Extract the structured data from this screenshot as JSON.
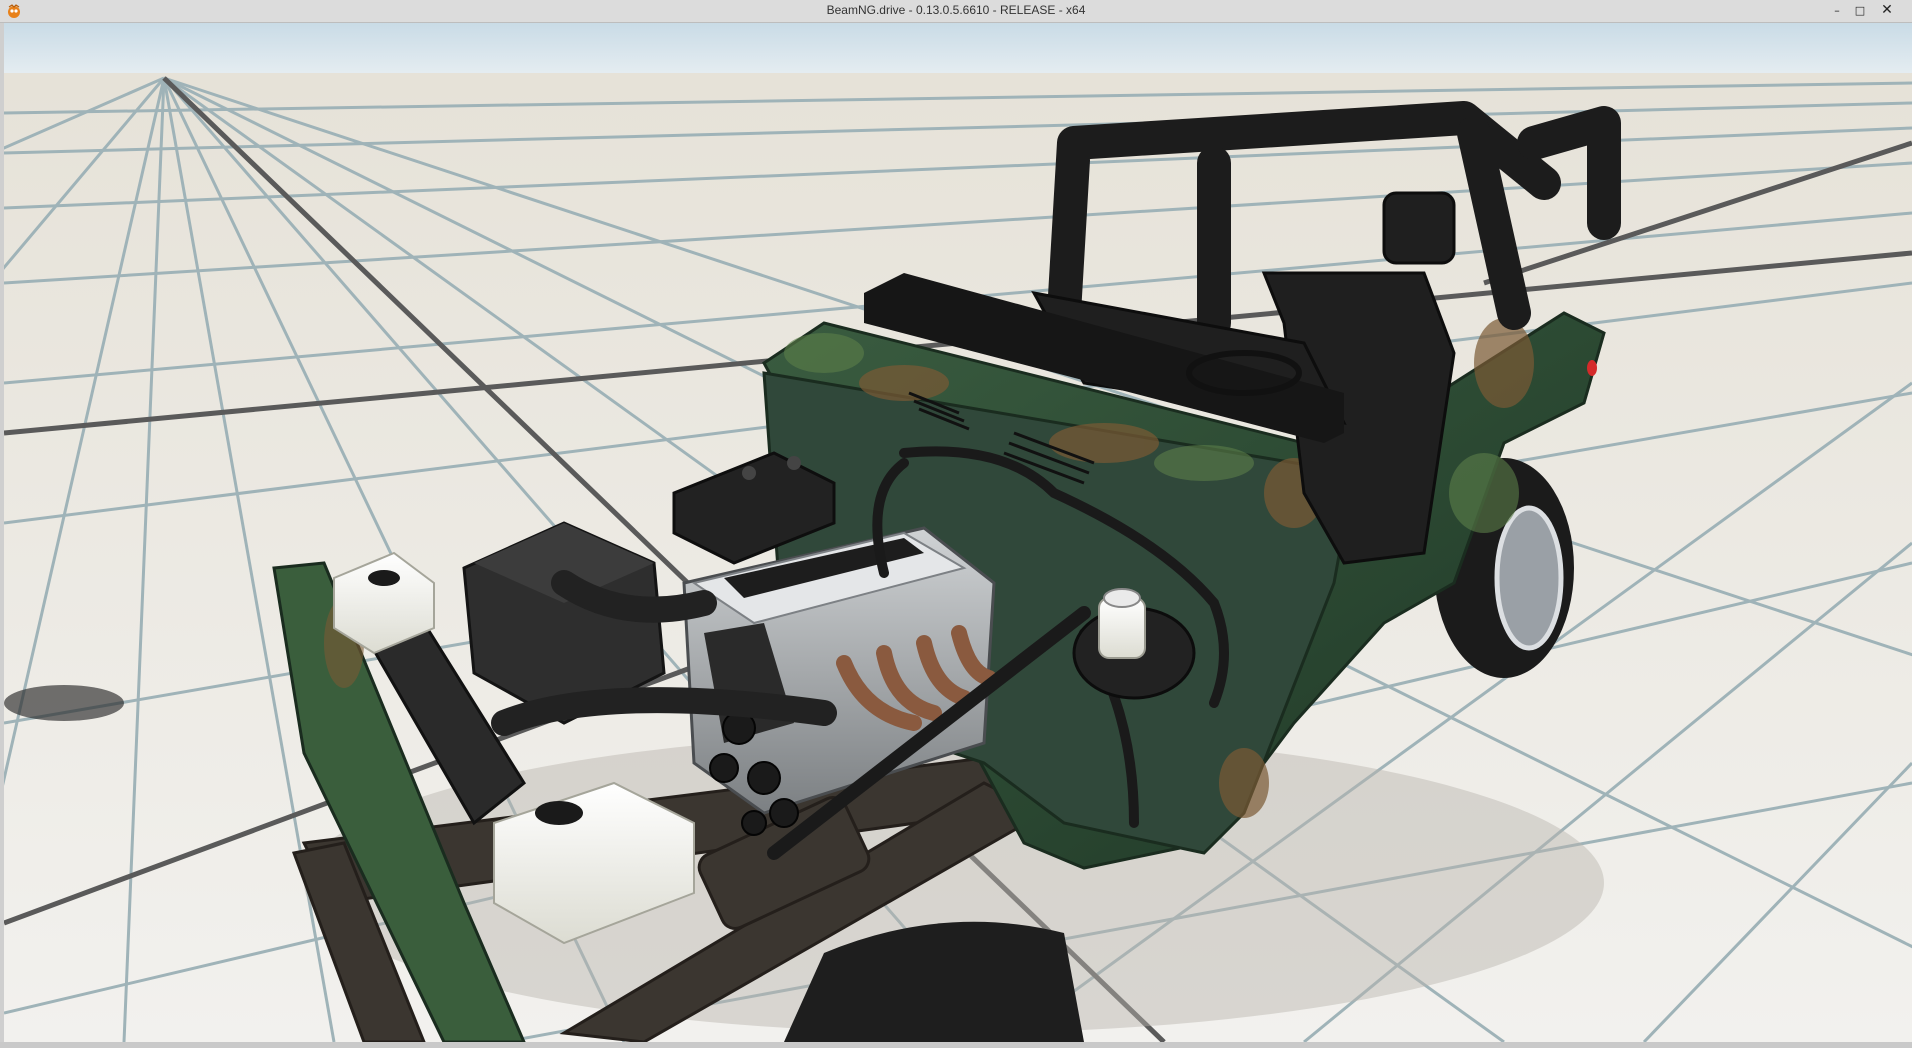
{
  "window": {
    "title": "BeamNG.drive - 0.13.0.5.6610 - RELEASE - x64",
    "controls": {
      "minimize": "–",
      "maximize": "□",
      "close": "✕"
    },
    "app_icon": "beamng-logo-icon"
  },
  "scene": {
    "description_icon": "3d-viewport",
    "vehicle_color_primary": "#2f4a32",
    "vehicle_color_secondary": "#4d6a3a",
    "camo_accent": "#7a5a34",
    "floor_color": "#e9e7e1",
    "grid_line_color": "#8ea4aa",
    "major_line_color": "#4a4a4a",
    "sky_color": "#cfdde6"
  }
}
